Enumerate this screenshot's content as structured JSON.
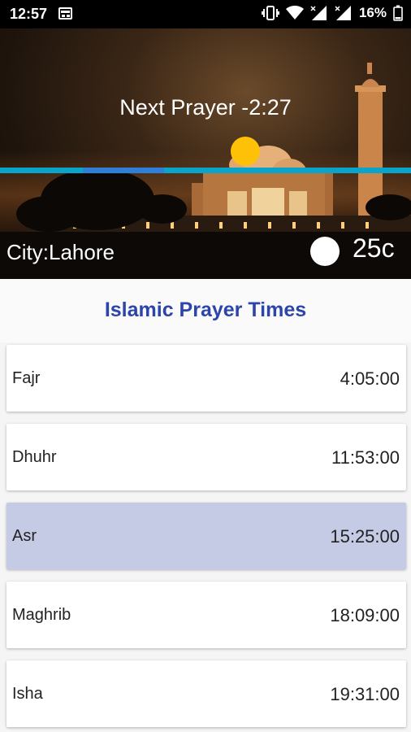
{
  "status_bar": {
    "time": "12:57",
    "battery": "16%",
    "icons": [
      "calendar-icon",
      "vibrate-icon",
      "wifi-icon",
      "signal-icon",
      "signal-icon",
      "battery-icon"
    ]
  },
  "hero": {
    "next_prayer": "Next Prayer -2:27",
    "city": "City:Lahore",
    "temperature": "25c"
  },
  "header": {
    "title": "Islamic Prayer Times"
  },
  "prayers": [
    {
      "name": "Fajr",
      "time": "4:05:00",
      "active": false
    },
    {
      "name": "Dhuhr",
      "time": "11:53:00",
      "active": false
    },
    {
      "name": "Asr",
      "time": "15:25:00",
      "active": true
    },
    {
      "name": "Maghrib",
      "time": "18:09:00",
      "active": false
    },
    {
      "name": "Isha",
      "time": "19:31:00",
      "active": false
    }
  ],
  "colors": {
    "title": "#2b45a8",
    "active_row": "#c5cae5",
    "sun": "#ffc107",
    "track": "#0aa3c9",
    "track_segment": "#2e7fd6"
  }
}
